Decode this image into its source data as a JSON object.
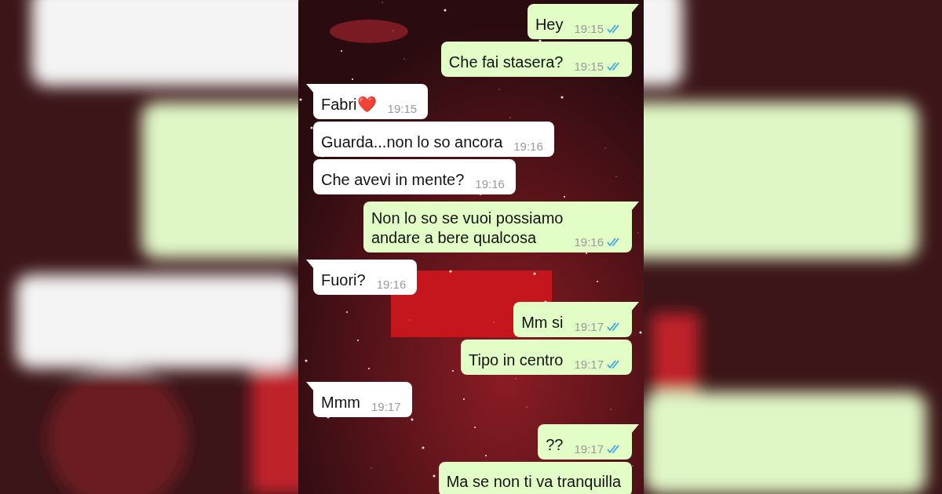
{
  "messages": [
    {
      "outgoing": true,
      "text": "Hey",
      "time": "19:15",
      "read": true
    },
    {
      "outgoing": true,
      "text": "Che fai stasera?",
      "time": "19:15",
      "read": true
    },
    {
      "outgoing": false,
      "text": "Fabri❤️",
      "time": "19:15"
    },
    {
      "outgoing": false,
      "text": "Guarda...non lo so ancora",
      "time": "19:16"
    },
    {
      "outgoing": false,
      "text": "Che avevi in mente?",
      "time": "19:16"
    },
    {
      "outgoing": true,
      "text": "Non lo so se vuoi possiamo\nandare a bere qualcosa",
      "time": "19:16",
      "read": true
    },
    {
      "outgoing": false,
      "text": "Fuori?",
      "time": "19:16"
    },
    {
      "outgoing": true,
      "text": "Mm si",
      "time": "19:17",
      "read": true
    },
    {
      "outgoing": true,
      "text": "Tipo in centro",
      "time": "19:17",
      "read": true
    },
    {
      "outgoing": false,
      "text": "Mmm",
      "time": "19:17"
    },
    {
      "outgoing": true,
      "text": "??",
      "time": "19:17",
      "read": true
    },
    {
      "outgoing": true,
      "text": "Ma se non ti va tranquilla"
    }
  ]
}
